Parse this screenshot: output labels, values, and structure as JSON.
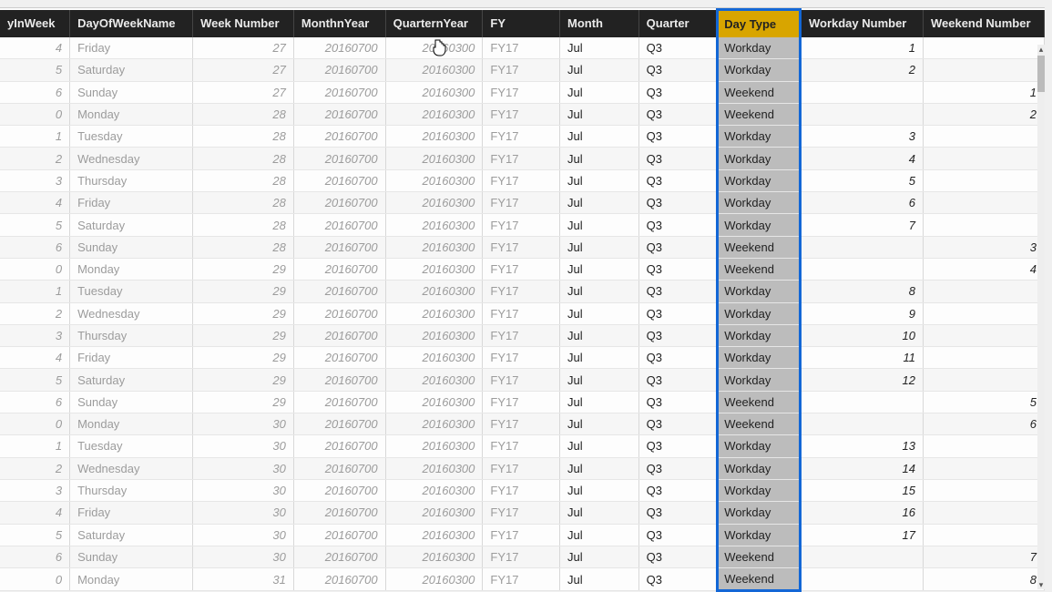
{
  "columns": [
    {
      "key": "dayInWeek",
      "label": "yInWeek",
      "cls": "col-dayinweek",
      "align": "num"
    },
    {
      "key": "dayName",
      "label": "DayOfWeekName",
      "cls": "col-dayname",
      "align": ""
    },
    {
      "key": "weekNum",
      "label": "Week Number",
      "cls": "col-weeknum",
      "align": "num"
    },
    {
      "key": "monthnYear",
      "label": "MonthnYear",
      "cls": "col-monthnyear",
      "align": "num"
    },
    {
      "key": "quarternYear",
      "label": "QuarternYear",
      "cls": "col-quarternyear",
      "align": "num"
    },
    {
      "key": "fy",
      "label": "FY",
      "cls": "col-fy",
      "align": ""
    },
    {
      "key": "month",
      "label": "Month",
      "cls": "col-month",
      "align": "",
      "dark": true
    },
    {
      "key": "quarter",
      "label": "Quarter",
      "cls": "col-quarter",
      "align": "",
      "dark": true
    },
    {
      "key": "dayType",
      "label": "Day Type",
      "cls": "col-daytype",
      "align": "",
      "sel": true
    },
    {
      "key": "workdayNum",
      "label": "Workday Number",
      "cls": "col-workday",
      "align": "num",
      "dark": true
    },
    {
      "key": "weekendNum",
      "label": "Weekend Number",
      "cls": "col-weekend",
      "align": "num",
      "dark": true
    }
  ],
  "rows": [
    {
      "dayInWeek": "4",
      "dayName": "Friday",
      "weekNum": "27",
      "monthnYear": "20160700",
      "quarternYear": "20160300",
      "fy": "FY17",
      "month": "Jul",
      "quarter": "Q3",
      "dayType": "Workday",
      "workdayNum": "1",
      "weekendNum": ""
    },
    {
      "dayInWeek": "5",
      "dayName": "Saturday",
      "weekNum": "27",
      "monthnYear": "20160700",
      "quarternYear": "20160300",
      "fy": "FY17",
      "month": "Jul",
      "quarter": "Q3",
      "dayType": "Workday",
      "workdayNum": "2",
      "weekendNum": ""
    },
    {
      "dayInWeek": "6",
      "dayName": "Sunday",
      "weekNum": "27",
      "monthnYear": "20160700",
      "quarternYear": "20160300",
      "fy": "FY17",
      "month": "Jul",
      "quarter": "Q3",
      "dayType": "Weekend",
      "workdayNum": "",
      "weekendNum": "1"
    },
    {
      "dayInWeek": "0",
      "dayName": "Monday",
      "weekNum": "28",
      "monthnYear": "20160700",
      "quarternYear": "20160300",
      "fy": "FY17",
      "month": "Jul",
      "quarter": "Q3",
      "dayType": "Weekend",
      "workdayNum": "",
      "weekendNum": "2"
    },
    {
      "dayInWeek": "1",
      "dayName": "Tuesday",
      "weekNum": "28",
      "monthnYear": "20160700",
      "quarternYear": "20160300",
      "fy": "FY17",
      "month": "Jul",
      "quarter": "Q3",
      "dayType": "Workday",
      "workdayNum": "3",
      "weekendNum": ""
    },
    {
      "dayInWeek": "2",
      "dayName": "Wednesday",
      "weekNum": "28",
      "monthnYear": "20160700",
      "quarternYear": "20160300",
      "fy": "FY17",
      "month": "Jul",
      "quarter": "Q3",
      "dayType": "Workday",
      "workdayNum": "4",
      "weekendNum": ""
    },
    {
      "dayInWeek": "3",
      "dayName": "Thursday",
      "weekNum": "28",
      "monthnYear": "20160700",
      "quarternYear": "20160300",
      "fy": "FY17",
      "month": "Jul",
      "quarter": "Q3",
      "dayType": "Workday",
      "workdayNum": "5",
      "weekendNum": ""
    },
    {
      "dayInWeek": "4",
      "dayName": "Friday",
      "weekNum": "28",
      "monthnYear": "20160700",
      "quarternYear": "20160300",
      "fy": "FY17",
      "month": "Jul",
      "quarter": "Q3",
      "dayType": "Workday",
      "workdayNum": "6",
      "weekendNum": ""
    },
    {
      "dayInWeek": "5",
      "dayName": "Saturday",
      "weekNum": "28",
      "monthnYear": "20160700",
      "quarternYear": "20160300",
      "fy": "FY17",
      "month": "Jul",
      "quarter": "Q3",
      "dayType": "Workday",
      "workdayNum": "7",
      "weekendNum": ""
    },
    {
      "dayInWeek": "6",
      "dayName": "Sunday",
      "weekNum": "28",
      "monthnYear": "20160700",
      "quarternYear": "20160300",
      "fy": "FY17",
      "month": "Jul",
      "quarter": "Q3",
      "dayType": "Weekend",
      "workdayNum": "",
      "weekendNum": "3"
    },
    {
      "dayInWeek": "0",
      "dayName": "Monday",
      "weekNum": "29",
      "monthnYear": "20160700",
      "quarternYear": "20160300",
      "fy": "FY17",
      "month": "Jul",
      "quarter": "Q3",
      "dayType": "Weekend",
      "workdayNum": "",
      "weekendNum": "4"
    },
    {
      "dayInWeek": "1",
      "dayName": "Tuesday",
      "weekNum": "29",
      "monthnYear": "20160700",
      "quarternYear": "20160300",
      "fy": "FY17",
      "month": "Jul",
      "quarter": "Q3",
      "dayType": "Workday",
      "workdayNum": "8",
      "weekendNum": ""
    },
    {
      "dayInWeek": "2",
      "dayName": "Wednesday",
      "weekNum": "29",
      "monthnYear": "20160700",
      "quarternYear": "20160300",
      "fy": "FY17",
      "month": "Jul",
      "quarter": "Q3",
      "dayType": "Workday",
      "workdayNum": "9",
      "weekendNum": ""
    },
    {
      "dayInWeek": "3",
      "dayName": "Thursday",
      "weekNum": "29",
      "monthnYear": "20160700",
      "quarternYear": "20160300",
      "fy": "FY17",
      "month": "Jul",
      "quarter": "Q3",
      "dayType": "Workday",
      "workdayNum": "10",
      "weekendNum": ""
    },
    {
      "dayInWeek": "4",
      "dayName": "Friday",
      "weekNum": "29",
      "monthnYear": "20160700",
      "quarternYear": "20160300",
      "fy": "FY17",
      "month": "Jul",
      "quarter": "Q3",
      "dayType": "Workday",
      "workdayNum": "11",
      "weekendNum": ""
    },
    {
      "dayInWeek": "5",
      "dayName": "Saturday",
      "weekNum": "29",
      "monthnYear": "20160700",
      "quarternYear": "20160300",
      "fy": "FY17",
      "month": "Jul",
      "quarter": "Q3",
      "dayType": "Workday",
      "workdayNum": "12",
      "weekendNum": ""
    },
    {
      "dayInWeek": "6",
      "dayName": "Sunday",
      "weekNum": "29",
      "monthnYear": "20160700",
      "quarternYear": "20160300",
      "fy": "FY17",
      "month": "Jul",
      "quarter": "Q3",
      "dayType": "Weekend",
      "workdayNum": "",
      "weekendNum": "5"
    },
    {
      "dayInWeek": "0",
      "dayName": "Monday",
      "weekNum": "30",
      "monthnYear": "20160700",
      "quarternYear": "20160300",
      "fy": "FY17",
      "month": "Jul",
      "quarter": "Q3",
      "dayType": "Weekend",
      "workdayNum": "",
      "weekendNum": "6"
    },
    {
      "dayInWeek": "1",
      "dayName": "Tuesday",
      "weekNum": "30",
      "monthnYear": "20160700",
      "quarternYear": "20160300",
      "fy": "FY17",
      "month": "Jul",
      "quarter": "Q3",
      "dayType": "Workday",
      "workdayNum": "13",
      "weekendNum": ""
    },
    {
      "dayInWeek": "2",
      "dayName": "Wednesday",
      "weekNum": "30",
      "monthnYear": "20160700",
      "quarternYear": "20160300",
      "fy": "FY17",
      "month": "Jul",
      "quarter": "Q3",
      "dayType": "Workday",
      "workdayNum": "14",
      "weekendNum": ""
    },
    {
      "dayInWeek": "3",
      "dayName": "Thursday",
      "weekNum": "30",
      "monthnYear": "20160700",
      "quarternYear": "20160300",
      "fy": "FY17",
      "month": "Jul",
      "quarter": "Q3",
      "dayType": "Workday",
      "workdayNum": "15",
      "weekendNum": ""
    },
    {
      "dayInWeek": "4",
      "dayName": "Friday",
      "weekNum": "30",
      "monthnYear": "20160700",
      "quarternYear": "20160300",
      "fy": "FY17",
      "month": "Jul",
      "quarter": "Q3",
      "dayType": "Workday",
      "workdayNum": "16",
      "weekendNum": ""
    },
    {
      "dayInWeek": "5",
      "dayName": "Saturday",
      "weekNum": "30",
      "monthnYear": "20160700",
      "quarternYear": "20160300",
      "fy": "FY17",
      "month": "Jul",
      "quarter": "Q3",
      "dayType": "Workday",
      "workdayNum": "17",
      "weekendNum": ""
    },
    {
      "dayInWeek": "6",
      "dayName": "Sunday",
      "weekNum": "30",
      "monthnYear": "20160700",
      "quarternYear": "20160300",
      "fy": "FY17",
      "month": "Jul",
      "quarter": "Q3",
      "dayType": "Weekend",
      "workdayNum": "",
      "weekendNum": "7"
    },
    {
      "dayInWeek": "0",
      "dayName": "Monday",
      "weekNum": "31",
      "monthnYear": "20160700",
      "quarternYear": "20160300",
      "fy": "FY17",
      "month": "Jul",
      "quarter": "Q3",
      "dayType": "Weekend",
      "workdayNum": "",
      "weekendNum": "8"
    }
  ]
}
